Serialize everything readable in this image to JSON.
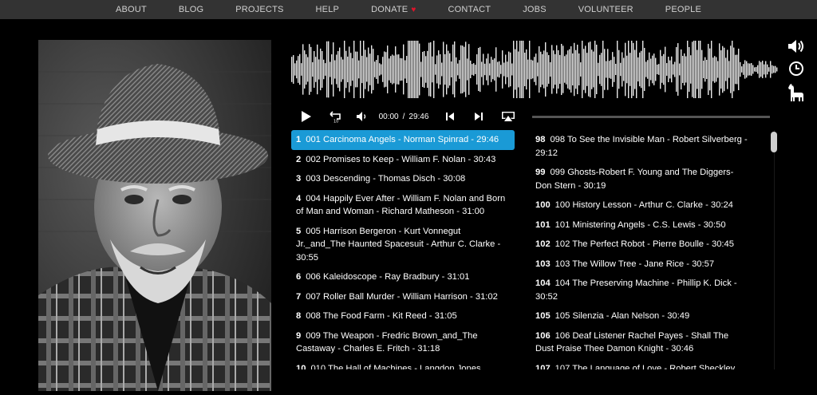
{
  "nav": {
    "items": [
      "ABOUT",
      "BLOG",
      "PROJECTS",
      "HELP",
      "DONATE",
      "CONTACT",
      "JOBS",
      "VOLUNTEER",
      "PEOPLE"
    ],
    "heart_icon": "heart-icon",
    "heart_color": "#e0142b"
  },
  "player": {
    "current_time": "00:00",
    "separator": "/",
    "duration": "29:46",
    "progress": 0.0,
    "accent_color": "#1a9ad6",
    "icons": [
      "play-icon",
      "replay-10-icon",
      "volume-icon",
      "previous-track-icon",
      "next-track-icon",
      "airplay-icon"
    ]
  },
  "side_icons": [
    "volume-icon",
    "clock-icon",
    "llama-icon"
  ],
  "playlist": {
    "left": [
      {
        "num": "1",
        "title": "001 Carcinoma Angels - Norman Spinrad  - 29:46",
        "active": true
      },
      {
        "num": "2",
        "title": "002 Promises to Keep - William F. Nolan  - 30:43"
      },
      {
        "num": "3",
        "title": "003 Descending - Thomas Disch  - 30:08"
      },
      {
        "num": "4",
        "title": "004 Happily Ever After - William F. Nolan and Born of Man and Woman - Richard Matheson  - 31:00"
      },
      {
        "num": "5",
        "title": "005 Harrison Bergeron - Kurt Vonnegut Jr._and_The Haunted Spacesuit - Arthur C. Clarke  - 30:55"
      },
      {
        "num": "6",
        "title": "006 Kaleidoscope - Ray Bradbury  - 31:01"
      },
      {
        "num": "7",
        "title": "007 Roller Ball Murder - William Harrison  - 31:02"
      },
      {
        "num": "8",
        "title": "008 The Food Farm - Kit Reed  - 31:05"
      },
      {
        "num": "9",
        "title": "009 The Weapon - Fredric Brown_and_The Castaway - Charles E. Fritch  - 31:18"
      },
      {
        "num": "10",
        "title": "010 The Hall of Machines - Langdon Jones"
      }
    ],
    "right": [
      {
        "num": "98",
        "title": "098 To See the Invisible Man - Robert Silverberg  - 29:12"
      },
      {
        "num": "99",
        "title": "099 Ghosts-Robert F. Young and The Diggers-Don Stern  - 30:19"
      },
      {
        "num": "100",
        "title": "100 History Lesson - Arthur C. Clarke  - 30:24"
      },
      {
        "num": "101",
        "title": "101 Ministering Angels - C.S. Lewis  - 30:50"
      },
      {
        "num": "102",
        "title": "102 The Perfect Robot - Pierre Boulle  - 30:45"
      },
      {
        "num": "103",
        "title": "103 The Willow Tree - Jane Rice  - 30:57"
      },
      {
        "num": "104",
        "title": "104 The Preserving Machine - Phillip K. Dick  - 30:52"
      },
      {
        "num": "105",
        "title": "105 Silenzia - Alan Nelson  - 30:49"
      },
      {
        "num": "106",
        "title": "106 Deaf Listener Rachel Payes - Shall The Dust Praise Thee Damon Knight  - 30:46"
      },
      {
        "num": "107",
        "title": "107 The Language of Love - Robert Sheckley"
      }
    ]
  }
}
